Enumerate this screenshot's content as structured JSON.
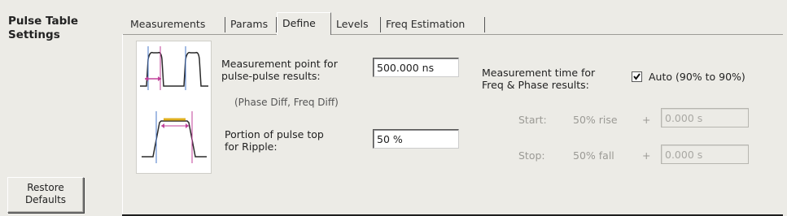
{
  "panel": {
    "title": "Pulse Table Settings",
    "title_line1": "Pulse Table",
    "title_line2": "Settings",
    "restore_line1": "Restore",
    "restore_line2": "Defaults"
  },
  "tabs": [
    {
      "label": "Measurements",
      "active": false
    },
    {
      "label": "Params",
      "active": false
    },
    {
      "label": "Define",
      "active": true
    },
    {
      "label": "Levels",
      "active": false
    },
    {
      "label": "Freq Estimation",
      "active": false
    }
  ],
  "define": {
    "measurement_point": {
      "label_line1": "Measurement point for",
      "label_line2": "pulse-pulse results:",
      "value": "500.000 ns",
      "note": "(Phase Diff, Freq Diff)"
    },
    "ripple": {
      "label_line1": "Portion of pulse top",
      "label_line2": "for Ripple:",
      "value": "50 %"
    },
    "measurement_time": {
      "label_line1": "Measurement time for",
      "label_line2": "Freq & Phase results:",
      "auto_label": "Auto (90% to 90%)",
      "auto_checked": true,
      "start_label": "Start:",
      "start_ref": "50% rise",
      "start_plus": "+",
      "start_value": "0.000 s",
      "stop_label": "Stop:",
      "stop_ref": "50% fall",
      "stop_plus": "+",
      "stop_value": "0.000 s"
    }
  },
  "colors": {
    "background": "#ecebe6",
    "marker": "#c0409a",
    "ripple_marker": "#e0b020",
    "ref_line": "#4a78c8"
  }
}
